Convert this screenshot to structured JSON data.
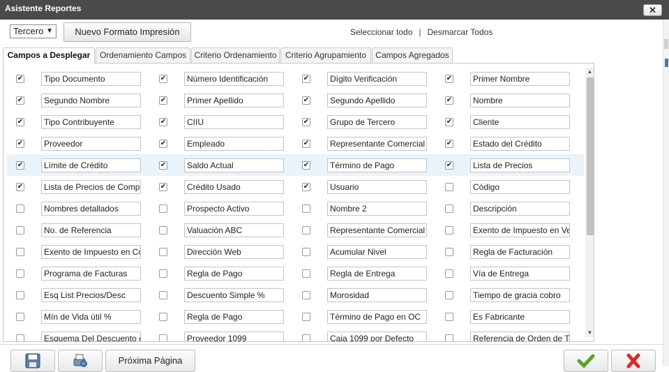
{
  "window": {
    "title": "Asistente Reportes",
    "close_label": "✕"
  },
  "toolbar": {
    "select_value": "Tercero",
    "print_format_label": "Nuevo Formato Impresión",
    "select_all_label": "Seleccionar todo",
    "separator": "|",
    "deselect_all_label": "Desmarcar Todos"
  },
  "tabs": [
    {
      "label": "Campos a Desplegar",
      "active": true
    },
    {
      "label": "Ordenamiento Campos",
      "active": false
    },
    {
      "label": "Criterio Ordenamiento",
      "active": false
    },
    {
      "label": "Criterio Agrupamiento",
      "active": false
    },
    {
      "label": "Campos Agregados",
      "active": false
    }
  ],
  "fields": [
    [
      {
        "label": "Tipo Documento",
        "checked": true
      },
      {
        "label": "Número Identificación",
        "checked": true
      },
      {
        "label": "Dígito Verificación",
        "checked": true
      },
      {
        "label": "Primer Nombre",
        "checked": true
      }
    ],
    [
      {
        "label": "Segundo Nombre",
        "checked": true
      },
      {
        "label": "Primer Apellido",
        "checked": true
      },
      {
        "label": "Segundo Apellido",
        "checked": true
      },
      {
        "label": "Nombre",
        "checked": true
      }
    ],
    [
      {
        "label": "Tipo Contribuyente",
        "checked": true
      },
      {
        "label": "CIIU",
        "checked": true
      },
      {
        "label": "Grupo de Tercero",
        "checked": true
      },
      {
        "label": "Cliente",
        "checked": true
      }
    ],
    [
      {
        "label": "Proveedor",
        "checked": true
      },
      {
        "label": "Empleado",
        "checked": true
      },
      {
        "label": "Representante Comercial",
        "checked": true
      },
      {
        "label": "Estado del Crédito",
        "checked": true
      }
    ],
    [
      {
        "label": "Límite de Crédito",
        "checked": true
      },
      {
        "label": "Saldo Actual",
        "checked": true
      },
      {
        "label": "Término de Pago",
        "checked": true
      },
      {
        "label": "Lista de Precios",
        "checked": true
      }
    ],
    [
      {
        "label": "Lista de Precios de Compra",
        "checked": true
      },
      {
        "label": "Crédito Usado",
        "checked": true
      },
      {
        "label": "Usuario",
        "checked": true
      },
      {
        "label": "Código",
        "checked": false
      }
    ],
    [
      {
        "label": "Nombres detallados",
        "checked": false
      },
      {
        "label": "Prospecto Activo",
        "checked": false
      },
      {
        "label": "Nombre 2",
        "checked": false
      },
      {
        "label": "Descripción",
        "checked": false
      }
    ],
    [
      {
        "label": "No. de Referencia",
        "checked": false
      },
      {
        "label": "Valuación ABC",
        "checked": false
      },
      {
        "label": "Representante Comercial",
        "checked": false
      },
      {
        "label": "Exento de Impuesto en Venta",
        "checked": false
      }
    ],
    [
      {
        "label": "Exento de Impuesto en Compra",
        "checked": false
      },
      {
        "label": "Dirección Web",
        "checked": false
      },
      {
        "label": "Acumular Nivel",
        "checked": false
      },
      {
        "label": "Regla de Facturación",
        "checked": false
      }
    ],
    [
      {
        "label": "Programa de Facturas",
        "checked": false
      },
      {
        "label": "Regla de Pago",
        "checked": false
      },
      {
        "label": "Regla de Entrega",
        "checked": false
      },
      {
        "label": "Vía de Entrega",
        "checked": false
      }
    ],
    [
      {
        "label": "Esq List Precios/Desc",
        "checked": false
      },
      {
        "label": "Descuento Simple %",
        "checked": false
      },
      {
        "label": "Morosidad",
        "checked": false
      },
      {
        "label": "Tiempo de gracia cobro",
        "checked": false
      }
    ],
    [
      {
        "label": "Mín de Vida útil %",
        "checked": false
      },
      {
        "label": "Regla de Pago",
        "checked": false
      },
      {
        "label": "Término de Pago en OC",
        "checked": false
      },
      {
        "label": "Es Fabricante",
        "checked": false
      }
    ],
    [
      {
        "label": "Esquema Del Descuento de",
        "checked": false
      },
      {
        "label": "Proveedor 1099",
        "checked": false
      },
      {
        "label": "Caja 1099 por Defecto",
        "checked": false
      },
      {
        "label": "Referencia de Orden de Tercero",
        "checked": false
      }
    ]
  ],
  "footer": {
    "save_icon": "save-icon",
    "preview_icon": "print-preview-icon",
    "next_page_label": "Próxima Página",
    "ok_icon": "check-icon",
    "cancel_icon": "cancel-icon",
    "ok_color": "#5aa02c",
    "cancel_color": "#d42a2a"
  }
}
